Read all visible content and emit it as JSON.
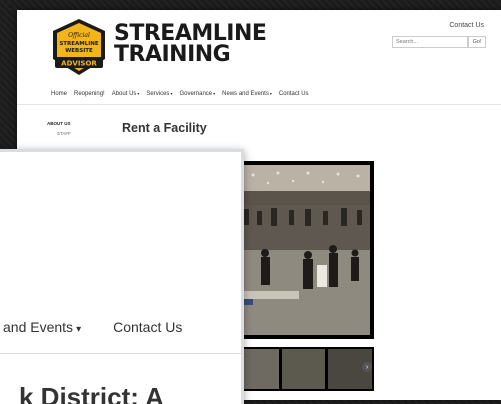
{
  "brand": {
    "line1": "STREAMLINE",
    "line2": "TRAINING"
  },
  "badge": {
    "line1": "Official",
    "line2": "STREAMLINE",
    "line3": "WEBSITE",
    "line4": "ADVISOR"
  },
  "header": {
    "contact_link": "Contact Us",
    "search_placeholder": "Search...",
    "search_button": "Go!"
  },
  "nav": {
    "items": [
      {
        "label": "Home",
        "dropdown": false
      },
      {
        "label": "Reopening!",
        "dropdown": false
      },
      {
        "label": "About Us",
        "dropdown": true
      },
      {
        "label": "Services",
        "dropdown": true
      },
      {
        "label": "Governance",
        "dropdown": true
      },
      {
        "label": "News and Events",
        "dropdown": true
      },
      {
        "label": "Contact Us",
        "dropdown": false
      }
    ],
    "caret": "▾"
  },
  "sidebar": {
    "section": "ABOUT US",
    "item": "STAFF"
  },
  "main": {
    "heading": "Rent a Facility"
  },
  "gallery": {
    "next_arrow": "›"
  },
  "zoom": {
    "nav_left": "and Events",
    "nav_right": "Contact Us",
    "heading_fragment": "k District: A"
  },
  "colors": {
    "badge_gold": "#f2b51c",
    "badge_dark": "#1b1b1b",
    "text_dark": "#333333"
  }
}
